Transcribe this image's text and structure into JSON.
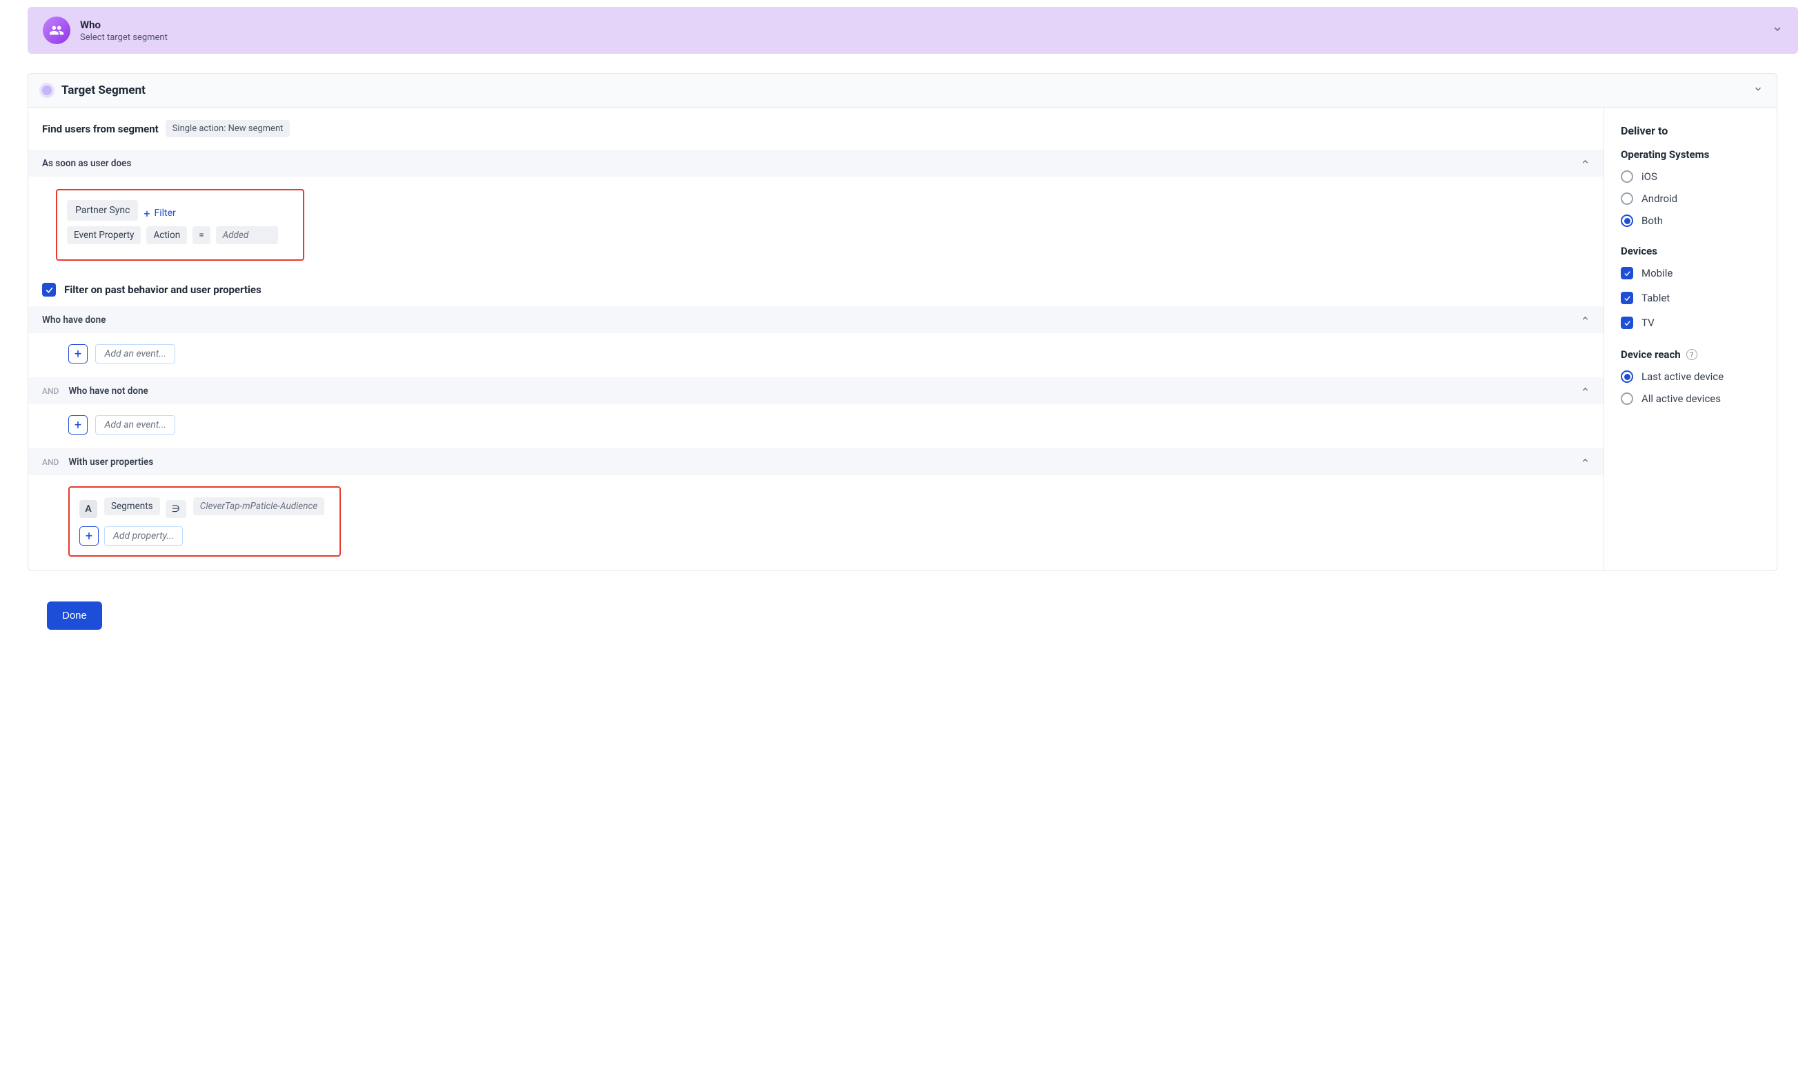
{
  "banner": {
    "title": "Who",
    "subtitle": "Select target segment"
  },
  "card": {
    "title": "Target Segment"
  },
  "segment": {
    "findLabel": "Find users from segment",
    "pill": "Single action: New segment"
  },
  "trigger": {
    "sectionTitle": "As soon as user does",
    "event": "Partner Sync",
    "filterLink": "Filter",
    "propLabel": "Event Property",
    "propKey": "Action",
    "operator": "=",
    "propValue": "Added"
  },
  "pastBehavior": {
    "checkboxLabel": "Filter on past behavior and user properties",
    "andLabel": "AND",
    "haveDone": {
      "title": "Who have done",
      "placeholder": "Add an event..."
    },
    "haveNotDone": {
      "title": "Who have not done",
      "placeholder": "Add an event..."
    },
    "userProps": {
      "title": "With user properties",
      "badge": "A",
      "key": "Segments",
      "op": "∋",
      "value": "CleverTap-mPaticle-Audience",
      "placeholder": "Add property..."
    }
  },
  "deliver": {
    "title": "Deliver to",
    "osTitle": "Operating Systems",
    "os": {
      "ios": "iOS",
      "android": "Android",
      "both": "Both",
      "selected": "both"
    },
    "devicesTitle": "Devices",
    "devices": {
      "mobile": "Mobile",
      "tablet": "Tablet",
      "tv": "TV"
    },
    "reachTitle": "Device reach",
    "reach": {
      "last": "Last active device",
      "all": "All active devices",
      "selected": "last"
    }
  },
  "doneLabel": "Done"
}
